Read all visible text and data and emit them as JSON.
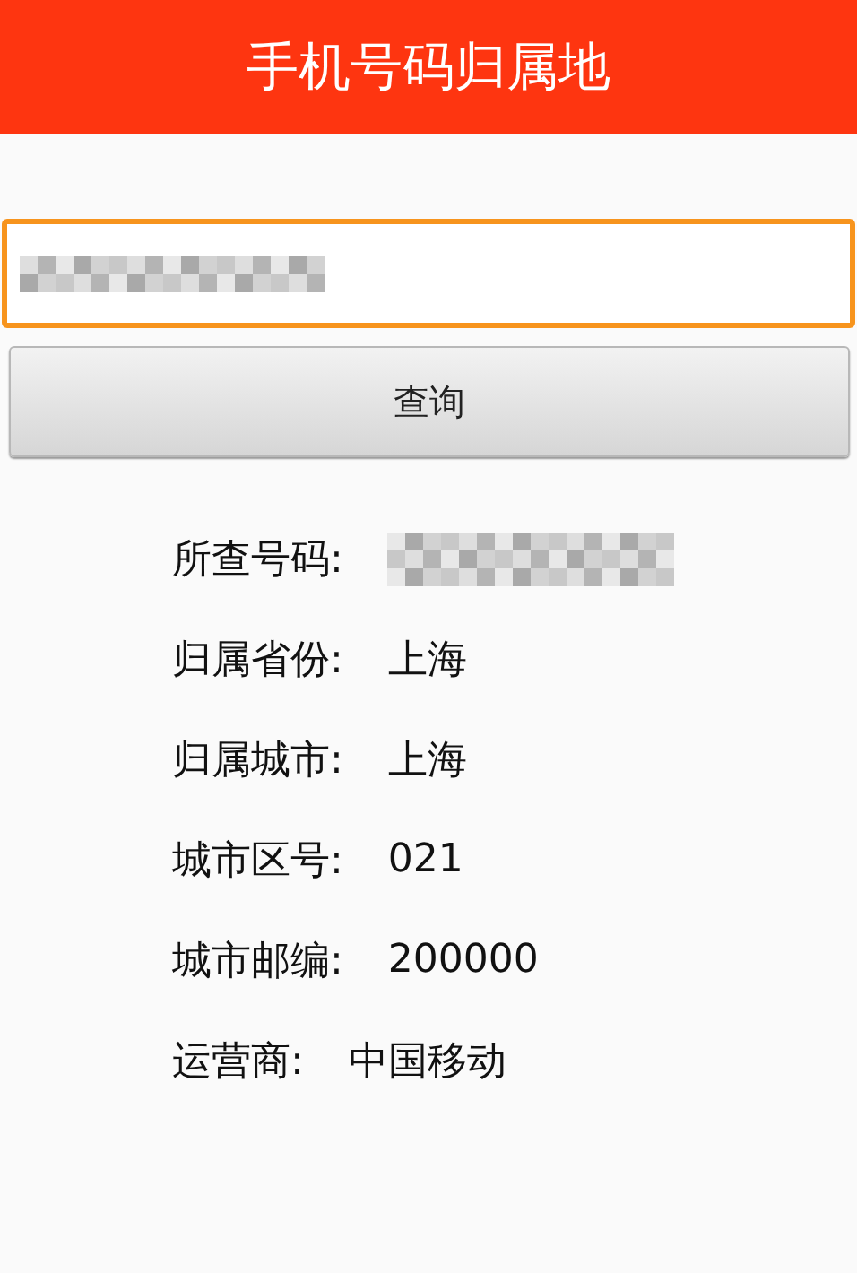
{
  "header": {
    "title": "手机号码归属地"
  },
  "phone_input": {
    "redacted": true
  },
  "query_button": {
    "label": "查询"
  },
  "results": [
    {
      "label": "所查号码:",
      "redacted": true
    },
    {
      "label": "归属省份:",
      "value": "上海"
    },
    {
      "label": "归属城市:",
      "value": "上海"
    },
    {
      "label": "城市区号:",
      "value": "021"
    },
    {
      "label": "城市邮编:",
      "value": "200000"
    },
    {
      "label": "运营商:",
      "value": "中国移动"
    }
  ]
}
